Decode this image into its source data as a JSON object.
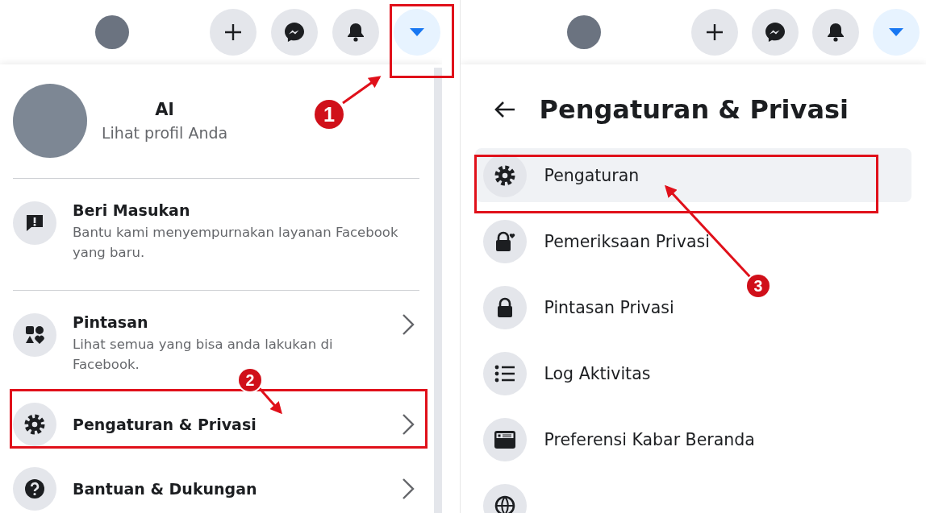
{
  "left_panel": {
    "top_bar": {
      "buttons": [
        {
          "selected": false
        },
        {
          "selected": false
        },
        {
          "selected": false
        },
        {
          "selected": true
        }
      ]
    },
    "profile": {
      "name": "Al",
      "link": "Lihat profil Anda"
    },
    "menu_groups": [
      [
        {
          "title": "Beri Masukan",
          "subtitle": "Bantu kami menyempurnakan layanan Facebook yang baru.",
          "chevron": false
        }
      ],
      [
        {
          "title": "Pintasan",
          "subtitle": "Lihat semua yang bisa anda lakukan di Facebook.",
          "chevron": true
        },
        {
          "title": "Pengaturan & Privasi",
          "chevron": true
        },
        {
          "title": "Bantuan & Dukungan",
          "chevron": true
        }
      ]
    ]
  },
  "right_panel": {
    "top_bar": {
      "buttons": [
        {
          "selected": false
        },
        {
          "selected": false
        },
        {
          "selected": false
        },
        {
          "selected": true
        }
      ]
    },
    "title": "Pengaturan & Privasi",
    "items": [
      {
        "label": "Pengaturan",
        "selected": true
      },
      {
        "label": "Pemeriksaan Privasi",
        "selected": false
      },
      {
        "label": "Pintasan Privasi",
        "selected": false
      },
      {
        "label": "Log Aktivitas",
        "selected": false
      },
      {
        "label": "Preferensi Kabar Beranda",
        "selected": false
      }
    ]
  },
  "annotations": [
    {
      "number": "1"
    },
    {
      "number": "2"
    },
    {
      "number": "3"
    }
  ]
}
